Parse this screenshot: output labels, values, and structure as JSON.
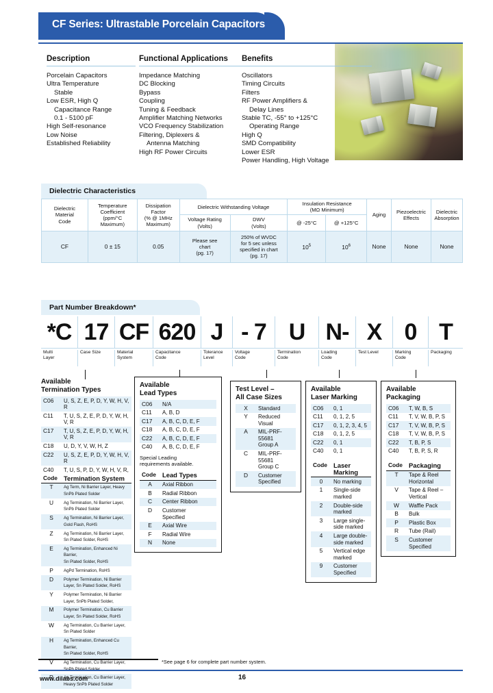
{
  "banner": {
    "title": "CF Series: Ultrastable Porcelain Capacitors"
  },
  "intro": {
    "description": {
      "heading": "Description",
      "items": [
        {
          "text": "Porcelain Capacitors",
          "indent": false
        },
        {
          "text": "Ultra Temperature",
          "indent": false
        },
        {
          "text": "Stable",
          "indent": true
        },
        {
          "text": "Low ESR, High Q",
          "indent": false
        },
        {
          "text": "Capacitance Range",
          "indent": true
        },
        {
          "text": "0.1 - 5100 pF",
          "indent": true
        },
        {
          "text": "High Self-resonance",
          "indent": false
        },
        {
          "text": "Low Noise",
          "indent": false
        },
        {
          "text": "Established Reliability",
          "indent": false
        }
      ]
    },
    "applications": {
      "heading": "Functional Applications",
      "items": [
        {
          "text": "Impedance Matching",
          "indent": false
        },
        {
          "text": "DC Blocking",
          "indent": false
        },
        {
          "text": "Bypass",
          "indent": false
        },
        {
          "text": "Coupling",
          "indent": false
        },
        {
          "text": "Tuning & Feedback",
          "indent": false
        },
        {
          "text": "Amplifier Matching Networks",
          "indent": false
        },
        {
          "text": "VCO Frequency Stabilization",
          "indent": false
        },
        {
          "text": "Filtering, Diplexers &",
          "indent": false
        },
        {
          "text": "Antenna Matching",
          "indent": true
        },
        {
          "text": "High RF Power Circuits",
          "indent": false
        }
      ]
    },
    "benefits": {
      "heading": "Benefits",
      "items": [
        {
          "text": "Oscillators",
          "indent": false
        },
        {
          "text": "Timing Circuits",
          "indent": false
        },
        {
          "text": "Filters",
          "indent": false
        },
        {
          "text": "RF Power Amplifiers &",
          "indent": false
        },
        {
          "text": "Delay Lines",
          "indent": true
        },
        {
          "text": "Stable TC, -55° to +125°C",
          "indent": false
        },
        {
          "text": "Operating Range",
          "indent": true
        },
        {
          "text": "High Q",
          "indent": false
        },
        {
          "text": "SMD Compatibility",
          "indent": false
        },
        {
          "text": "Lower ESR",
          "indent": false
        },
        {
          "text": "Power Handling, High Voltage",
          "indent": false
        }
      ]
    }
  },
  "dielectric": {
    "heading": "Dielectric Characteristics",
    "headers": {
      "material_code": "Dielectric\nMaterial\nCode",
      "material_code_l1": "Dielectric",
      "material_code_l2": "Material",
      "material_code_l3": "Code",
      "tempco_l1": "Temperature",
      "tempco_l2": "Coefficient",
      "tempco_l3": "(ppm/°C",
      "tempco_l4": "Maximum)",
      "df_l1": "Dissipation",
      "df_l2": "Factor",
      "df_l3": "(% @ 1MHz",
      "df_l4": "Maximum)",
      "dwv_group": "Dielectric Withstanding Voltage",
      "voltage_rating_l1": "Voltage Rating",
      "voltage_rating_l2": "(Volts)",
      "dwv_l1": "DWV",
      "dwv_l2": "(Volts)",
      "ir_group_l1": "Insulation Resistance",
      "ir_group_l2": "(MΩ Minimum)",
      "ir_cold": "@ -25°C",
      "ir_hot": "@ +125°C",
      "aging": "Aging",
      "piezo_l1": "Piezoelectric",
      "piezo_l2": "Effects",
      "da_l1": "Dielectric",
      "da_l2": "Absorption"
    },
    "row": {
      "material_code": "CF",
      "tempco": "0 ± 15",
      "df": "0.05",
      "voltage_rating_l1": "Please see",
      "voltage_rating_l2": "chart",
      "voltage_rating_l3": "(pg. 17)",
      "dwv_l1": "250% of WVDC",
      "dwv_l2": "for 5 sec unless",
      "dwv_l3": "specified in chart",
      "dwv_l4": "(pg. 17)",
      "ir_cold_base": "10",
      "ir_cold_exp": "5",
      "ir_hot_base": "10",
      "ir_hot_exp": "6",
      "aging": "None",
      "piezo": "None",
      "da": "None"
    }
  },
  "part_number": {
    "heading": "Part Number Breakdown*",
    "segments": [
      {
        "value": "*C",
        "label_l1": "Multi",
        "label_l2": "Layer"
      },
      {
        "value": "17",
        "label_l1": "Case Size",
        "label_l2": ""
      },
      {
        "value": "CF",
        "label_l1": "Material",
        "label_l2": "System"
      },
      {
        "value": "620",
        "label_l1": "Capacitance",
        "label_l2": "Code"
      },
      {
        "value": "J",
        "label_l1": "Tolerance",
        "label_l2": "Level"
      },
      {
        "value": "- 7",
        "label_l1": "Voltage",
        "label_l2": "Code"
      },
      {
        "value": "U",
        "label_l1": "Termination",
        "label_l2": "Code"
      },
      {
        "value": "N-",
        "label_l1": "Loading",
        "label_l2": "Code"
      },
      {
        "value": "X",
        "label_l1": "Test Level",
        "label_l2": ""
      },
      {
        "value": "0",
        "label_l1": "Marking",
        "label_l2": "Code"
      },
      {
        "value": "T",
        "label_l1": "Packaging",
        "label_l2": ""
      }
    ]
  },
  "termination_types": {
    "heading_l1": "Available",
    "heading_l2": "Termination Types",
    "rows": [
      {
        "case": "C06",
        "codes": "U, S, Z, E, P, D, Y, W, H, V, R"
      },
      {
        "case": "C11",
        "codes": "T, U, S, Z, E, P, D, Y, W, H, V, R"
      },
      {
        "case": "C17",
        "codes": "T, U, S, Z, E, P, D, Y, W, H, V, R"
      },
      {
        "case": "C18",
        "codes": "U, D, Y, V, W, H, Z"
      },
      {
        "case": "C22",
        "codes": "U, S, Z, E, P, D, Y, W, H, V, R"
      },
      {
        "case": "C40",
        "codes": "T, U, S, P, D, Y, W, H, V, R,"
      }
    ],
    "table_head_code": "Code",
    "table_head_desc": "Termination System",
    "systems": [
      {
        "code": "T",
        "l1": "Ag Term, Ni Barrier Layer, Heavy",
        "l2": "SnPb Plated Solder"
      },
      {
        "code": "U",
        "l1": "Ag Termination, Ni Barrier Layer,",
        "l2": "SnPb Plated Solder"
      },
      {
        "code": "S",
        "l1": "Ag Termination, Ni Barrier Layer,",
        "l2": "Gold Flash, RoHS"
      },
      {
        "code": "Z",
        "l1": "Ag Termination, Ni Barrier Layer,",
        "l2": "Sn Plated Solder, RoHS"
      },
      {
        "code": "E",
        "l1": "Ag Termination, Enhanced Ni Barrier,",
        "l2": "Sn Plated Solder, RoHS"
      },
      {
        "code": "P",
        "l1": "AgPd Termination, RoHS",
        "l2": ""
      },
      {
        "code": "D",
        "l1": "Polymer Termination, Ni Barrier",
        "l2": "Layer, Sn Plated Solder, RoHS"
      },
      {
        "code": "Y",
        "l1": "Polymer Termination, Ni Barrier",
        "l2": "Layer, SnPb Plated Solder,"
      },
      {
        "code": "M",
        "l1": "Polymer Termination, Cu Barrier",
        "l2": "Layer, Sn Plated Solder, RoHS"
      },
      {
        "code": "W",
        "l1": "Ag Termination, Cu Barrier Layer,",
        "l2": "Sn Plated Solder"
      },
      {
        "code": "H",
        "l1": "Ag Termination, Enhanced Cu Barrier,",
        "l2": "Sn Plated Solder, RoHS"
      },
      {
        "code": "V",
        "l1": "Ag Termination, Cu Barrier Layer,",
        "l2": "SnPb Plated Solder"
      },
      {
        "code": "R",
        "l1": "Ag Termination, Cu Barrier Layer,",
        "l2": "Heavy SnPb Plated Solder"
      }
    ]
  },
  "lead_types": {
    "heading_l1": "Available",
    "heading_l2": "Lead Types",
    "rows": [
      {
        "case": "C06",
        "codes": "N/A"
      },
      {
        "case": "C11",
        "codes": "A, B, D"
      },
      {
        "case": "C17",
        "codes": "A, B, C, D, E, F"
      },
      {
        "case": "C18",
        "codes": "A, B, C, D, E, F"
      },
      {
        "case": "C22",
        "codes": "A, B, C, D, E, F"
      },
      {
        "case": "C40",
        "codes": "A, B, C, D, E, F"
      }
    ],
    "note_l1": "Special Leading",
    "note_l2": "requirements available.",
    "table_head_code": "Code",
    "table_head_desc": "Lead Types",
    "systems": [
      {
        "code": "A",
        "l1": "Axial Ribbon",
        "l2": ""
      },
      {
        "code": "B",
        "l1": "Radial Ribbon",
        "l2": ""
      },
      {
        "code": "C",
        "l1": "Center Ribbon",
        "l2": ""
      },
      {
        "code": "D",
        "l1": "Customer",
        "l2": "Specified"
      },
      {
        "code": "E",
        "l1": "Axial Wire",
        "l2": ""
      },
      {
        "code": "F",
        "l1": "Radial Wire",
        "l2": ""
      },
      {
        "code": "N",
        "l1": "None",
        "l2": ""
      }
    ]
  },
  "test_level": {
    "heading_l1": "Test Level –",
    "heading_l2": "All Case Sizes",
    "rows": [
      {
        "code": "X",
        "l1": "Standard",
        "l2": ""
      },
      {
        "code": "Y",
        "l1": "Reduced Visual",
        "l2": ""
      },
      {
        "code": "A",
        "l1": "MIL-PRF-55681",
        "l2": "Group A"
      },
      {
        "code": "C",
        "l1": "MIL-PRF-55681",
        "l2": "Group C"
      },
      {
        "code": "D",
        "l1": "Customer",
        "l2": "Specified"
      }
    ]
  },
  "laser_marking": {
    "heading_l1": "Available",
    "heading_l2": "Laser Marking",
    "rows": [
      {
        "case": "C06",
        "codes": "0, 1"
      },
      {
        "case": "C11",
        "codes": "0, 1, 2, 5"
      },
      {
        "case": "C17",
        "codes": "0, 1, 2, 3, 4, 5"
      },
      {
        "case": "C18",
        "codes": "0, 1, 2, 5"
      },
      {
        "case": "C22",
        "codes": "0, 1"
      },
      {
        "case": "C40",
        "codes": "0, 1"
      }
    ],
    "table_head_code": "Code",
    "table_head_desc": "Laser Marking",
    "systems": [
      {
        "code": "0",
        "l1": "No marking",
        "l2": ""
      },
      {
        "code": "1",
        "l1": "Single-side",
        "l2": "marked"
      },
      {
        "code": "2",
        "l1": "Double-side",
        "l2": "marked"
      },
      {
        "code": "3",
        "l1": "Large single-",
        "l2": "side marked"
      },
      {
        "code": "4",
        "l1": "Large double-",
        "l2": "side marked"
      },
      {
        "code": "5",
        "l1": "Vertical edge",
        "l2": "marked"
      },
      {
        "code": "9",
        "l1": "Customer",
        "l2": "Specified"
      }
    ]
  },
  "packaging": {
    "heading_l1": "Available",
    "heading_l2": "Packaging",
    "rows": [
      {
        "case": "C06",
        "codes": "T, W, B, S"
      },
      {
        "case": "C11",
        "codes": "T, V, W, B, P, S"
      },
      {
        "case": "C17",
        "codes": "T, V, W, B, P, S"
      },
      {
        "case": "C18",
        "codes": "T, V, W, B, P, S"
      },
      {
        "case": "C22",
        "codes": "T, B, P, S"
      },
      {
        "case": "C40",
        "codes": "T, B, P, S, R"
      }
    ],
    "table_head_code": "Code",
    "table_head_desc": "Packaging",
    "systems": [
      {
        "code": "T",
        "l1": "Tape & Reel",
        "l2": "Horizontal"
      },
      {
        "code": "V",
        "l1": "Tape & Reel –",
        "l2": "Vertical"
      },
      {
        "code": "W",
        "l1": "Waffle Pack",
        "l2": ""
      },
      {
        "code": "B",
        "l1": "Bulk",
        "l2": ""
      },
      {
        "code": "P",
        "l1": "Plastic Box",
        "l2": ""
      },
      {
        "code": "R",
        "l1": "Tube (Rail)",
        "l2": ""
      },
      {
        "code": "S",
        "l1": "Customer",
        "l2": "Specified"
      }
    ]
  },
  "footer": {
    "note": "*See page 6 for complete part number system.",
    "website": "www.dilabs.com",
    "page": "16"
  }
}
